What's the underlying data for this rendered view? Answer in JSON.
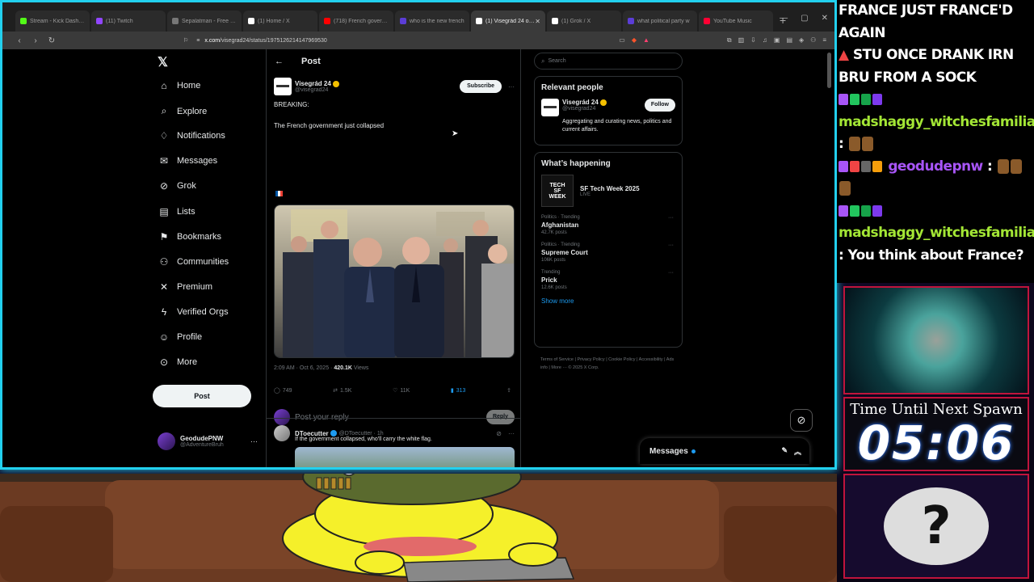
{
  "browser": {
    "tabs": [
      {
        "label": "Stream - Kick Dashbo",
        "fav": "#53fc18",
        "active": false
      },
      {
        "label": "(11) Twitch",
        "fav": "#9146ff",
        "active": false
      },
      {
        "label": "Sepalatman - Free Dis",
        "fav": "#777777",
        "active": false
      },
      {
        "label": "(1) Home / X",
        "fav": "#ffffff",
        "active": false
      },
      {
        "label": "(718) French governme",
        "fav": "#ff0000",
        "active": false
      },
      {
        "label": "who is the new french",
        "fav": "#5b3dd6",
        "active": false
      },
      {
        "label": "(1) Visegrád 24 on X",
        "fav": "#ffffff",
        "active": true
      },
      {
        "label": "(1) Grok / X",
        "fav": "#ffffff",
        "active": false
      },
      {
        "label": "what political party w",
        "fav": "#5b3dd6",
        "active": false
      },
      {
        "label": "YouTube Music",
        "fav": "#ff0033",
        "active": false
      }
    ],
    "url_host": "x.com",
    "url_path": "/visegrad24/status/1975126214147969530"
  },
  "x": {
    "nav": [
      {
        "label": "Home",
        "icon": "home-icon",
        "glyph": "⌂"
      },
      {
        "label": "Explore",
        "icon": "search-icon",
        "glyph": "⌕"
      },
      {
        "label": "Notifications",
        "icon": "bell-icon",
        "glyph": "♢"
      },
      {
        "label": "Messages",
        "icon": "envelope-icon",
        "glyph": "✉"
      },
      {
        "label": "Grok",
        "icon": "grok-icon",
        "glyph": "⊘"
      },
      {
        "label": "Lists",
        "icon": "list-icon",
        "glyph": "▤"
      },
      {
        "label": "Bookmarks",
        "icon": "bookmark-icon",
        "glyph": "⚑"
      },
      {
        "label": "Communities",
        "icon": "people-icon",
        "glyph": "⚇"
      },
      {
        "label": "Premium",
        "icon": "x-logo-icon",
        "glyph": "✕"
      },
      {
        "label": "Verified Orgs",
        "icon": "lightning-icon",
        "glyph": "ϟ"
      },
      {
        "label": "Profile",
        "icon": "person-icon",
        "glyph": "☺"
      },
      {
        "label": "More",
        "icon": "more-circle-icon",
        "glyph": "⊙"
      }
    ],
    "post_button": "Post",
    "account": {
      "name": "GeodudePNW",
      "handle": "@AdventureBruh"
    },
    "header_title": "Post",
    "tweet": {
      "author": "Visegrád 24",
      "handle": "@visegrad24",
      "subscribe": "Subscribe",
      "line1": "BREAKING:",
      "line2": "The French government just collapsed",
      "time": "2:09 AM · Oct 6, 2025 · ",
      "views_count": "420.1K",
      "views_label": " Views",
      "replies": "749",
      "reposts": "1.5K",
      "likes": "11K",
      "bookmarks": "313"
    },
    "reply_placeholder": "Post your reply",
    "reply_button": "Reply",
    "reply_tweet": {
      "author": "DToecutter",
      "handle": "@DToecutter · 1h",
      "text": "If the government collapsed, who'll carry the white flag."
    },
    "search_placeholder": "Search",
    "relevant": {
      "title": "Relevant people",
      "name": "Visegrád 24",
      "handle": "@visegrad24",
      "follow": "Follow",
      "bio": "Aggregating and curating news, politics and current affairs."
    },
    "happening": {
      "title": "What’s happening",
      "event_title": "SF Tech Week 2025",
      "event_sub": "LIVE",
      "event_img_l1": "TECH",
      "event_img_l2": "SF",
      "event_img_l3": "WEEK",
      "trends": [
        {
          "meta": "Politics · Trending",
          "name": "Afghanistan",
          "count": "42.7K posts"
        },
        {
          "meta": "Politics · Trending",
          "name": "Supreme Court",
          "count": "106K posts"
        },
        {
          "meta": "Trending",
          "name": "Prick",
          "count": "12.6K posts"
        }
      ],
      "show_more": "Show more"
    },
    "footer": "Terms of Service  |  Privacy Policy  |  Cookie Policy  |  Accessibility  |  Ads info  |  More ···  © 2025 X Corp.",
    "messages_drawer": "Messages"
  },
  "chat": {
    "header_line1": "FRANCE JUST FRANCE'D AGAIN",
    "header_line2": "STU ONCE DRANK IRN BRU FROM A SOCK",
    "messages": [
      {
        "user": "madshaggy_witchesfamiliar",
        "text": ""
      },
      {
        "user": "geodudepnw",
        "text": ""
      },
      {
        "user": "madshaggy_witchesfamiliar",
        "text": "You think about France?"
      }
    ]
  },
  "timer": {
    "label": "Time Until Next Spawn",
    "value": "05:06"
  },
  "mystery": {
    "glyph": "?"
  }
}
